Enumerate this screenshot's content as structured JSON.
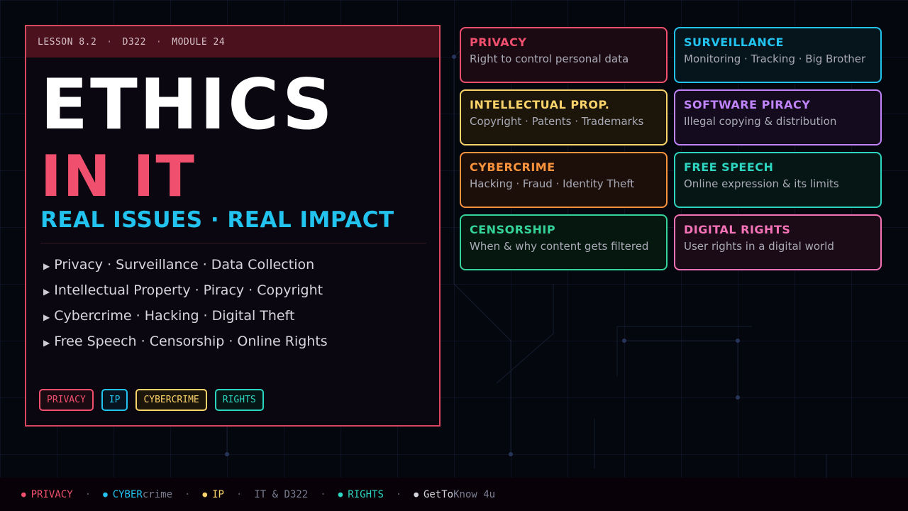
{
  "header": {
    "lesson": "LESSON 8.2",
    "course": "D322",
    "module": "MODULE 24",
    "separator": "·"
  },
  "title": {
    "line1": "ETHICS",
    "line2": "IN IT",
    "subtitle": "REAL ISSUES · REAL IMPACT"
  },
  "bullets": [
    "Privacy · Surveillance · Data Collection",
    "Intellectual Property · Piracy · Copyright",
    "Cybercrime · Hacking · Digital Theft",
    "Free Speech · Censorship · Online Rights"
  ],
  "bullet_marker": "▶",
  "tags": [
    {
      "label": "PRIVACY",
      "color": "#f0506e",
      "bg": "#1a0a12"
    },
    {
      "label": "IP",
      "color": "#22c3ee",
      "bg": "#071420"
    },
    {
      "label": "CYBERCRIME",
      "color": "#fbd36b",
      "bg": "#1c150a"
    },
    {
      "label": "RIGHTS",
      "color": "#2dd4bf",
      "bg": "#061614"
    }
  ],
  "cards": [
    {
      "title": "PRIVACY",
      "desc": "Right to control personal data",
      "color": "#f0506e",
      "bg": "#1c0a12"
    },
    {
      "title": "SURVEILLANCE",
      "desc": "Monitoring · Tracking · Big Brother",
      "color": "#22c3ee",
      "bg": "#06141c"
    },
    {
      "title": "INTELLECTUAL PROP.",
      "desc": "Copyright · Patents · Trademarks",
      "color": "#fbd36b",
      "bg": "#1c150a"
    },
    {
      "title": "SOFTWARE PIRACY",
      "desc": "Illegal copying & distribution",
      "color": "#c084fc",
      "bg": "#140c1e"
    },
    {
      "title": "CYBERCRIME",
      "desc": "Hacking · Fraud · Identity Theft",
      "color": "#fb923c",
      "bg": "#1c0f0a"
    },
    {
      "title": "FREE SPEECH",
      "desc": "Online expression & its limits",
      "color": "#2dd4bf",
      "bg": "#051614"
    },
    {
      "title": "CENSORSHIP",
      "desc": "When & why content gets filtered",
      "color": "#34d399",
      "bg": "#06170f"
    },
    {
      "title": "DIGITAL RIGHTS",
      "desc": "User rights in a digital world",
      "color": "#f472b6",
      "bg": "#1a0b16"
    }
  ],
  "footer": {
    "separator": "·",
    "dot": "●",
    "privacy": {
      "text": "PRIVACY",
      "color": "#f0506e"
    },
    "cyber": {
      "strong": "CYBER",
      "rest": "crime",
      "color": "#22c3ee"
    },
    "ip": {
      "text": "IP",
      "color": "#fbd36b"
    },
    "course": "IT & D322",
    "rights": {
      "text": "RIGHTS",
      "color": "#2dd4bf"
    },
    "brand": {
      "strong": "GetTo",
      "rest": "Know 4u",
      "color": "#d4d4dc"
    }
  }
}
